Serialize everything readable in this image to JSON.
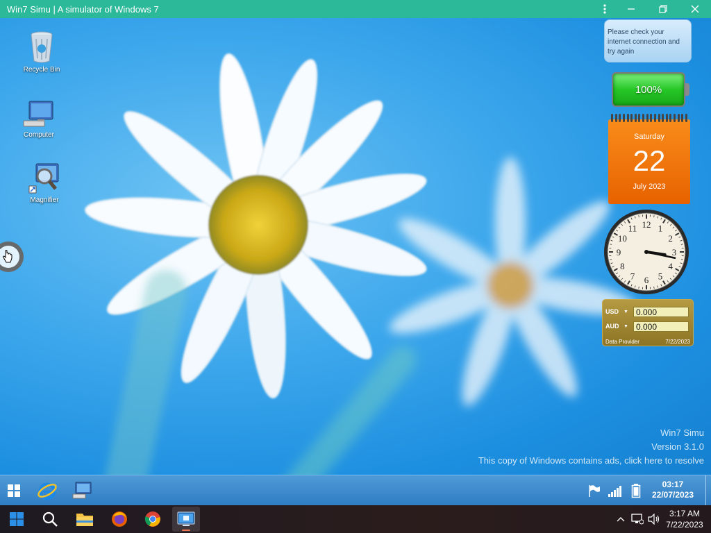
{
  "window": {
    "title": "Win7 Simu | A simulator of Windows 7"
  },
  "desktop_icons": [
    {
      "label": "Recycle Bin",
      "icon": "recycle-bin-icon"
    },
    {
      "label": "Computer",
      "icon": "computer-icon"
    },
    {
      "label": "Magnifier",
      "icon": "magnifier-icon"
    }
  ],
  "gadgets": {
    "network_message": "Please check your internet connection and try again",
    "battery": {
      "percent_label": "100%",
      "level": 1.0,
      "color": "#27c727"
    },
    "calendar": {
      "weekday": "Saturday",
      "day": "22",
      "month_year": "July 2023",
      "color": "#e76200"
    },
    "clock": {
      "numbers": [
        "12",
        "1",
        "2",
        "3",
        "4",
        "5",
        "6",
        "7",
        "8",
        "9",
        "10",
        "11"
      ],
      "hours": 3,
      "minutes": 17
    },
    "currency": {
      "rows": [
        {
          "code": "USD",
          "value": "0.000"
        },
        {
          "code": "AUD",
          "value": "0.000"
        }
      ],
      "provider": "Data Provider",
      "date": "7/22/2023"
    }
  },
  "watermark": {
    "line1": "Win7 Simu",
    "line2": "Version 3.1.0",
    "line3": "This copy of Windows contains ads, click here to resolve"
  },
  "win7_taskbar": {
    "time": "03:17",
    "date": "22/07/2023"
  },
  "host_taskbar": {
    "time": "3:17 AM",
    "date": "7/22/2023"
  }
}
